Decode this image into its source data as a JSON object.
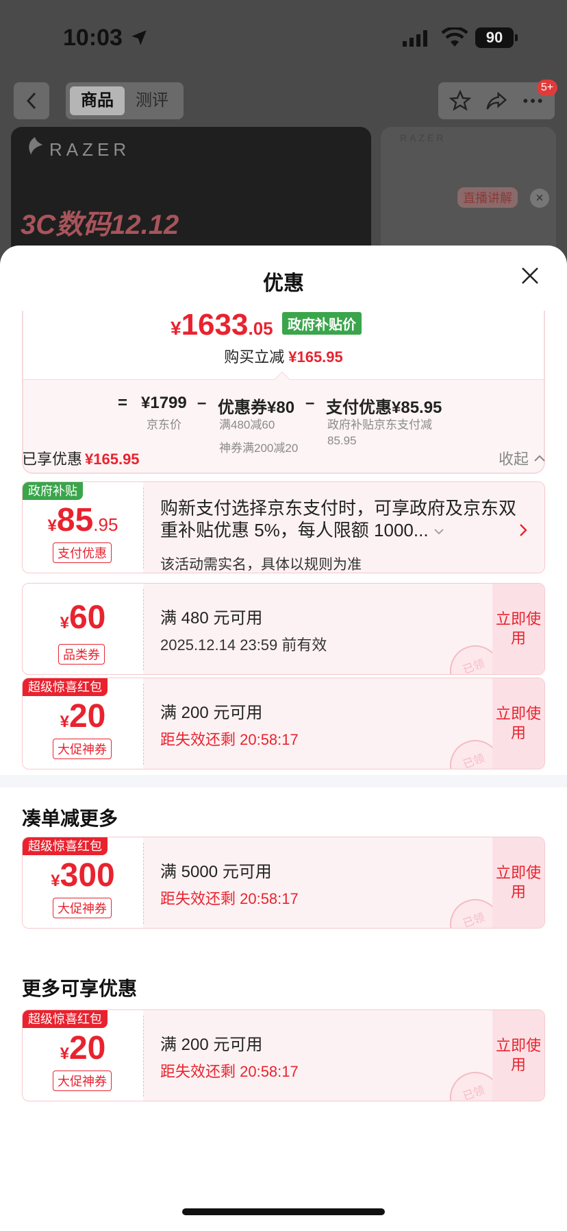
{
  "status_bar": {
    "time": "10:03",
    "battery": "90"
  },
  "nav": {
    "tabs": [
      {
        "label": "商品",
        "active": true
      },
      {
        "label": "测评",
        "active": false
      }
    ],
    "badge": "5+"
  },
  "banner": {
    "brand": "RAZER",
    "promo": "3C数码12.12",
    "live_label": "直播讲解",
    "brand2": "RAZER"
  },
  "sheet": {
    "title": "优惠",
    "final_price": {
      "symbol": "¥",
      "integer": "1633",
      "decimal": ".05"
    },
    "gov_tag": "政府补贴价",
    "reduce_label": "购买立减",
    "reduce_amount": "¥165.95",
    "breakdown": {
      "equals": "=",
      "items": [
        {
          "value": "¥1799",
          "sub": "京东价"
        },
        {
          "op": "–",
          "value": "优惠券¥80",
          "sub": "满480减60",
          "sub2": "神券满200减20"
        },
        {
          "op": "–",
          "value": "支付优惠¥85.95",
          "sub": "政府补贴京东支付减85.95"
        }
      ]
    },
    "enjoyed_label": "已享优惠",
    "enjoyed_amount": "¥165.95",
    "collapse_label": "收起"
  },
  "coupons": [
    {
      "corner_tag": "政府补贴",
      "corner_color": "#3aa54b",
      "symbol": "¥",
      "amount": "85",
      "decimal": ".95",
      "type": "支付优惠",
      "desc": "购新支付选择京东支付时，可享政府及京东双重补贴优惠 5%，每人限额 1000...",
      "rule": "该活动需实名，具体以规则为准"
    },
    {
      "corner_tag": "",
      "symbol": "¥",
      "amount": "60",
      "type": "品类券",
      "title": "满 480 元可用",
      "sub": "2025.12.14 23:59 前有效",
      "sub_red": false,
      "button": "立即使用",
      "stamp": "已领"
    },
    {
      "corner_tag": "超级惊喜红包",
      "corner_color": "#e8232f",
      "symbol": "¥",
      "amount": "20",
      "type": "大促神券",
      "title": "满 200 元可用",
      "sub": "距失效还剩 20:58:17",
      "sub_red": true,
      "button": "立即使用",
      "stamp": "已领"
    }
  ],
  "section_more_reduce": {
    "title": "凑单减更多",
    "coupon": {
      "corner_tag": "超级惊喜红包",
      "symbol": "¥",
      "amount": "300",
      "type": "大促神券",
      "title": "满 5000 元可用",
      "sub": "距失效还剩 20:58:17",
      "button": "立即使用",
      "stamp": "已领"
    }
  },
  "section_more_offers": {
    "title": "更多可享优惠",
    "coupon": {
      "corner_tag": "超级惊喜红包",
      "symbol": "¥",
      "amount": "20",
      "type": "大促神券",
      "title": "满 200 元可用",
      "sub": "距失效还剩 20:58:17",
      "button": "立即使用",
      "stamp": "已领"
    }
  },
  "colors": {
    "accent_red": "#e8232f",
    "gov_green": "#3aa54b",
    "card_bg": "#fdf2f3"
  }
}
